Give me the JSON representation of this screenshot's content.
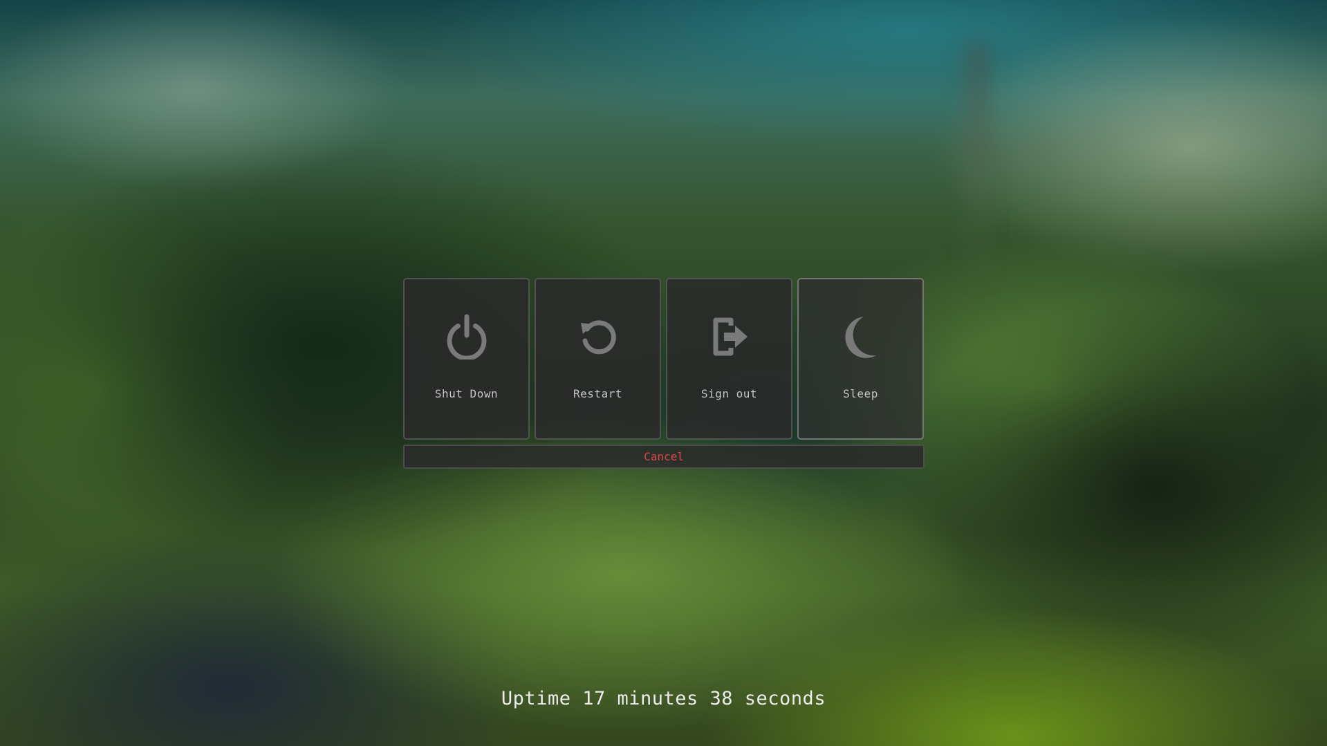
{
  "colors": {
    "icon": "#7a7a7a",
    "label": "#c4c4c4",
    "cancel": "#e04545",
    "uptime": "#ececec",
    "panel": "#2a2a2a"
  },
  "actions": [
    {
      "label": "Shut Down",
      "icon": "power-icon"
    },
    {
      "label": "Restart",
      "icon": "restart-icon"
    },
    {
      "label": "Sign out",
      "icon": "sign-out-icon"
    },
    {
      "label": "Sleep",
      "icon": "moon-icon"
    }
  ],
  "cancel_label": "Cancel",
  "uptime_text": "Uptime 17 minutes 38 seconds"
}
